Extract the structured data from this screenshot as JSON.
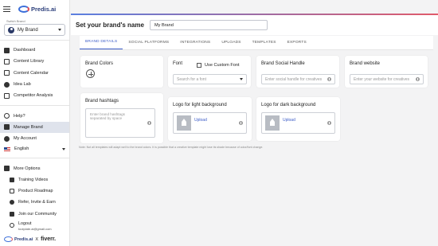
{
  "sidebar": {
    "logo_text": "Predis.ai",
    "brand_switch_label": "Switch Brand",
    "brand_select_value": "My Brand",
    "nav_primary": [
      {
        "label": "Dashboard",
        "icon": "dashboard-icon"
      },
      {
        "label": "Content Library",
        "icon": "library-icon"
      },
      {
        "label": "Content Calendar",
        "icon": "calendar-icon"
      },
      {
        "label": "Idea Lab",
        "icon": "lightbulb-icon"
      },
      {
        "label": "Competitor Analysis",
        "icon": "analysis-icon"
      }
    ],
    "nav_secondary": [
      {
        "label": "Help?",
        "icon": "help-icon"
      },
      {
        "label": "Manage Brand",
        "icon": "brand-icon",
        "active": true
      },
      {
        "label": "My Account",
        "icon": "account-icon"
      }
    ],
    "language": "English",
    "more_options": "More Options",
    "sub_items": [
      {
        "label": "Training Videos",
        "icon": "video-icon"
      },
      {
        "label": "Product Roadmap",
        "icon": "roadmap-icon"
      },
      {
        "label": "Refer, Invite & Earn",
        "icon": "refer-icon"
      },
      {
        "label": "Join our Community",
        "icon": "community-icon"
      }
    ],
    "logout_label": "Logout",
    "logout_email": "toolplate.ai@gmail.com",
    "partner_predis": "Predis.ai",
    "partner_x": "X",
    "partner_fiverr": "fiverr."
  },
  "header": {
    "title": "Set your brand's name",
    "brand_name_value": "My Brand"
  },
  "tabs": [
    {
      "label": "BRAND DETAILS",
      "active": true
    },
    {
      "label": "SOCIAL PLATFORMS"
    },
    {
      "label": "INTEGRATIONS"
    },
    {
      "label": "UPLOADS"
    },
    {
      "label": "TEMPLATES"
    },
    {
      "label": "EXPORTS"
    }
  ],
  "cards": {
    "brand_colors": {
      "title": "Brand Colors"
    },
    "font": {
      "title": "Font",
      "custom_font_label": "Use Custom Font",
      "placeholder": "Search for a font"
    },
    "social_handle": {
      "title": "Brand Social Handle",
      "placeholder": "Enter social handle for creatives"
    },
    "website": {
      "title": "Brand website",
      "placeholder": "Enter your website for creatives"
    },
    "hashtags": {
      "title": "Brand hashtags",
      "placeholder_line1": "Enter brand hashtags",
      "placeholder_line2": "separated by space"
    },
    "logo_light": {
      "title": "Logo for light background",
      "upload_label": "Upload"
    },
    "logo_dark": {
      "title": "Logo for dark background",
      "upload_label": "Upload"
    }
  },
  "note": "Note: Not all templates will adapt well to the brand colors. It is possible that a creative template might lose its shade because of color/font change.",
  "colors": {
    "accent": "#3b5bc7",
    "active_nav_bg": "#dfe3ec",
    "brand_gradient_start": "#5a7fe0",
    "brand_gradient_end": "#e05a6a"
  }
}
